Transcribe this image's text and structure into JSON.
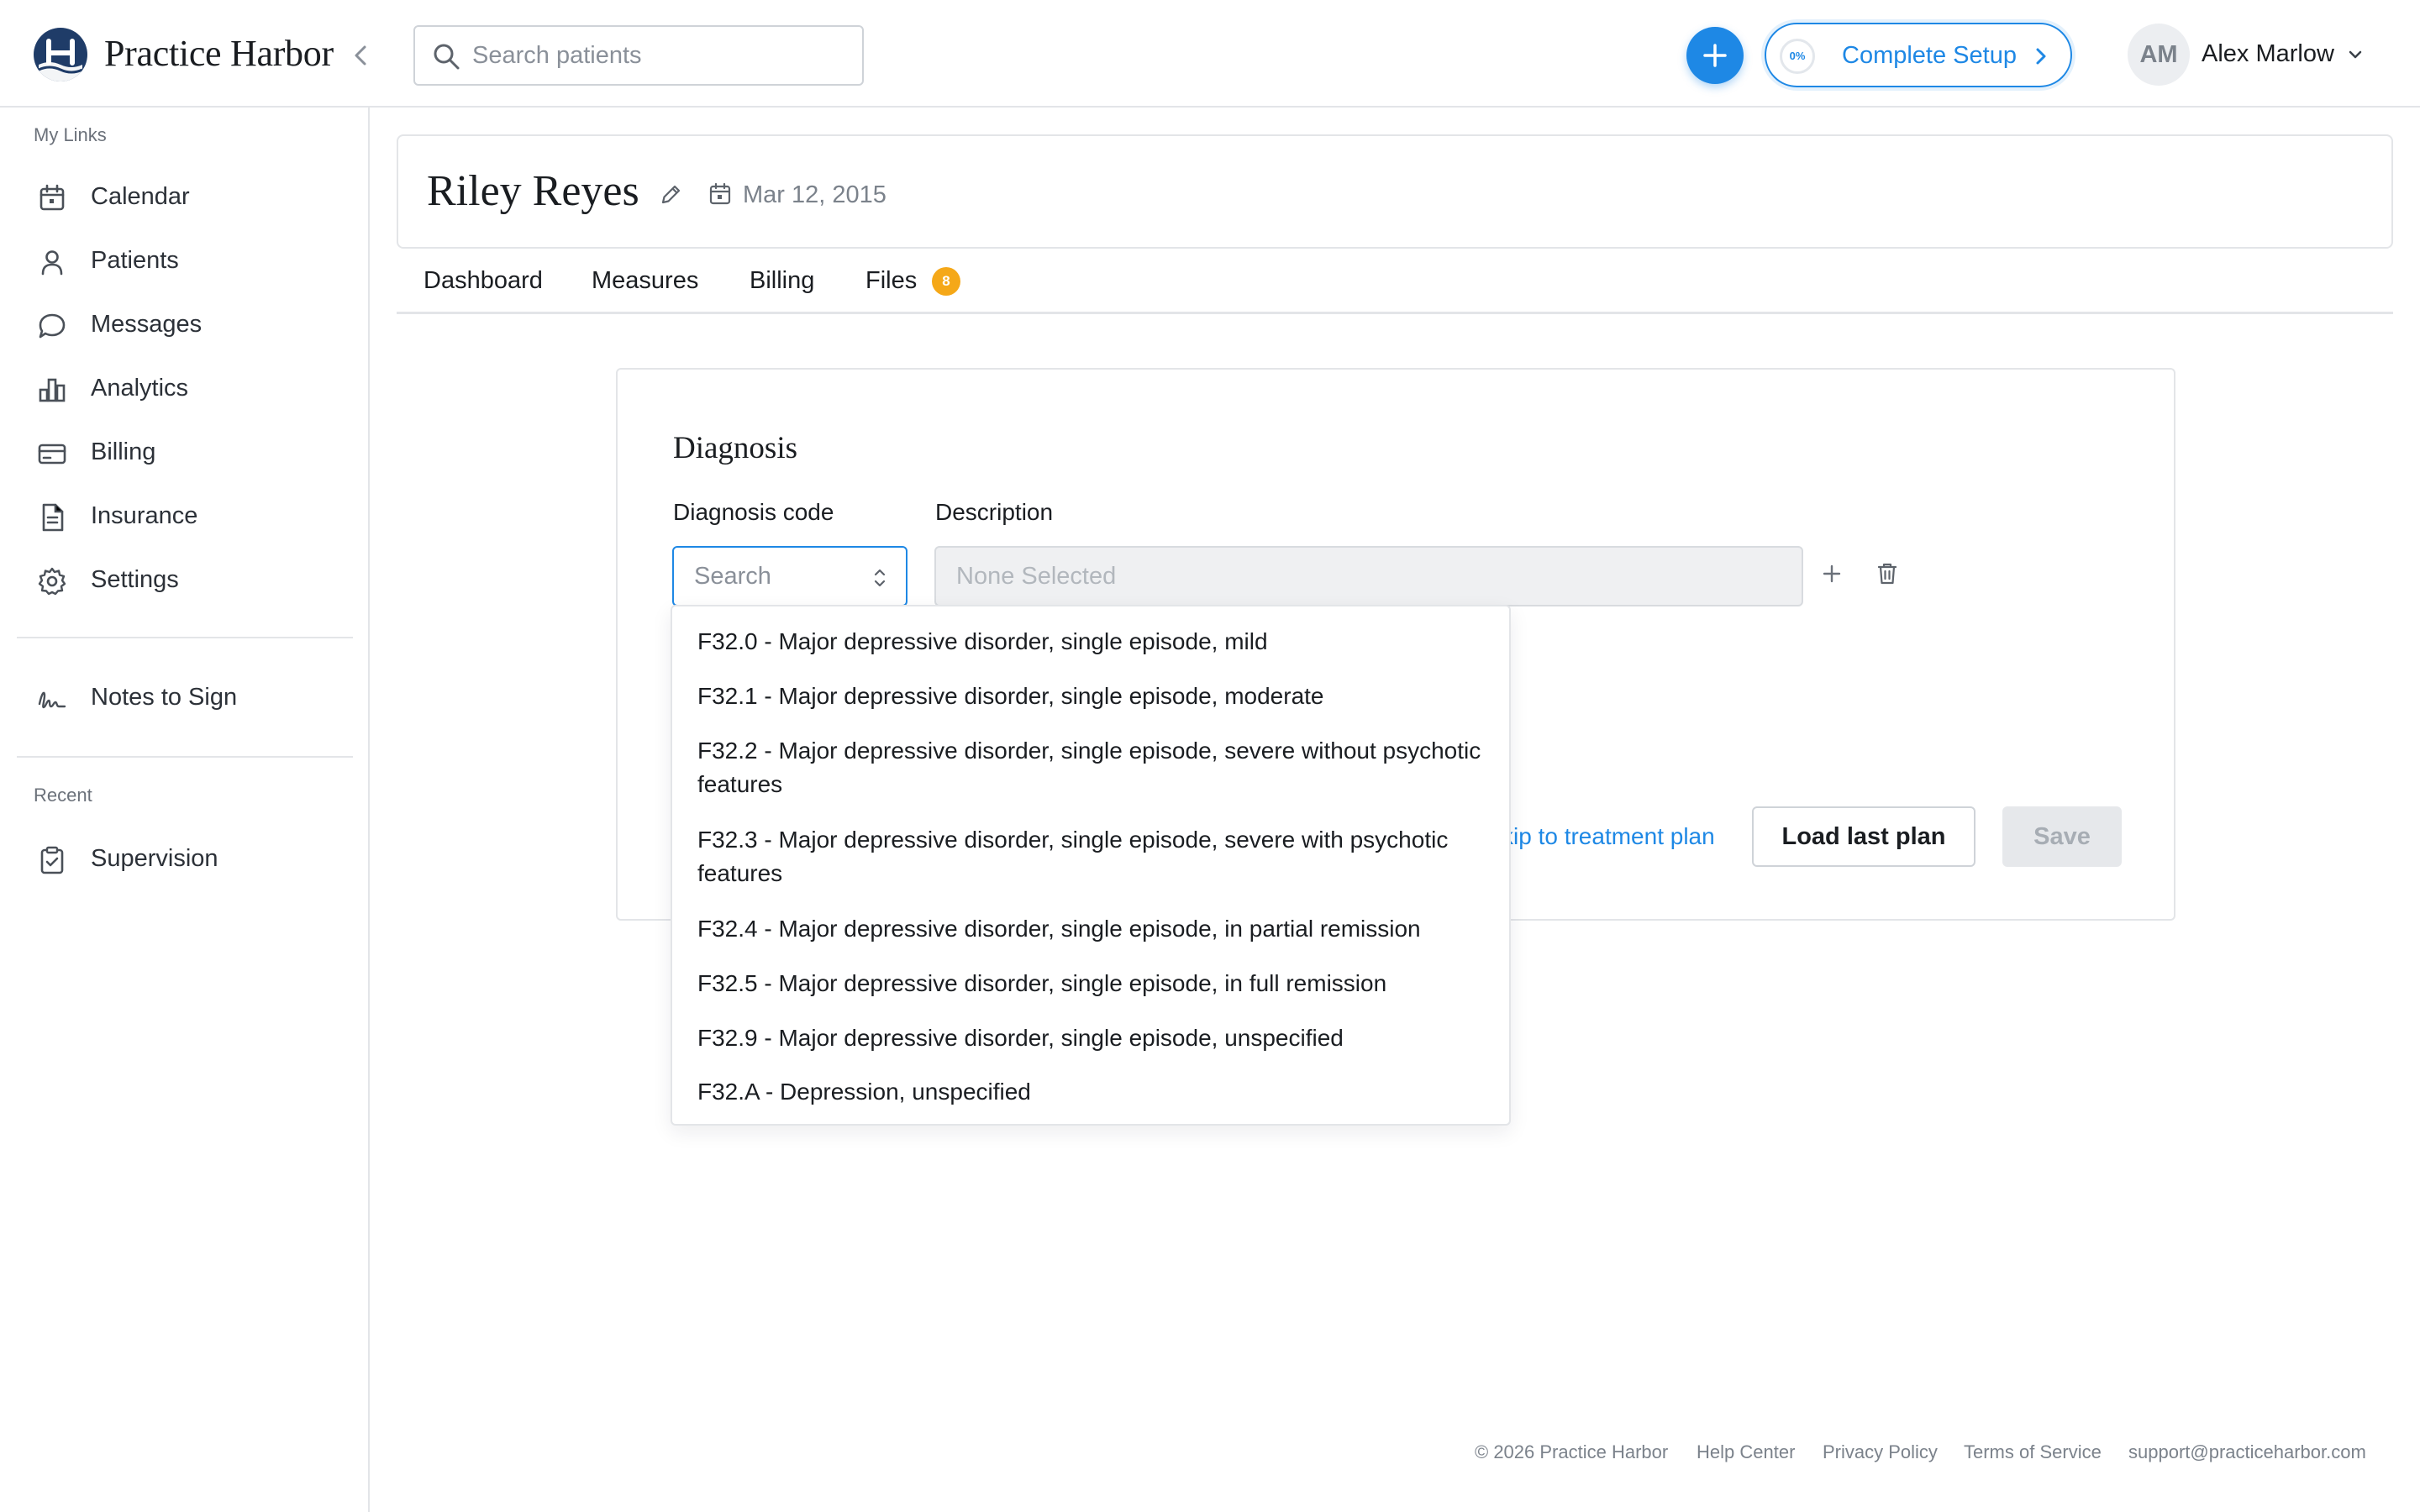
{
  "app": {
    "brand": "Practice Harbor",
    "collapse_icon": "chevron-left-icon"
  },
  "topbar": {
    "search_placeholder": "Search patients",
    "add_icon": "plus-icon",
    "setup": {
      "progress_label": "0%",
      "progress_value": 0,
      "label": "Complete Setup"
    },
    "user": {
      "initials": "AM",
      "name": "Alex Marlow"
    }
  },
  "sidebar": {
    "my_links_label": "My Links",
    "items": [
      {
        "label": "Calendar",
        "icon": "calendar-icon"
      },
      {
        "label": "Patients",
        "icon": "user-icon"
      },
      {
        "label": "Messages",
        "icon": "chat-bubble-icon"
      },
      {
        "label": "Analytics",
        "icon": "bar-chart-icon"
      },
      {
        "label": "Billing",
        "icon": "card-icon"
      },
      {
        "label": "Insurance",
        "icon": "document-icon"
      },
      {
        "label": "Settings",
        "icon": "gear-icon"
      }
    ],
    "notes_to_sign": "Notes to Sign",
    "recent_label": "Recent",
    "recent_items": [
      {
        "label": "Supervision",
        "icon": "clipboard-check-icon"
      }
    ]
  },
  "patient": {
    "name": "Riley Reyes",
    "dob": "Mar 12, 2015"
  },
  "tabs": [
    {
      "label": "Dashboard"
    },
    {
      "label": "Measures"
    },
    {
      "label": "Billing"
    },
    {
      "label": "Files",
      "badge": "8"
    }
  ],
  "diagnosis": {
    "title": "Diagnosis",
    "code_label": "Diagnosis code",
    "description_label": "Description",
    "code_placeholder": "Search",
    "description_placeholder": "None Selected",
    "options": [
      "F32.0 - Major depressive disorder, single episode, mild",
      "F32.1 - Major depressive disorder, single episode, moderate",
      "F32.2 - Major depressive disorder, single episode, severe without psychotic features",
      "F32.3 - Major depressive disorder, single episode, severe with psychotic features",
      "F32.4 - Major depressive disorder, single episode, in partial remission",
      "F32.5 - Major depressive disorder, single episode, in full remission",
      "F32.9 - Major depressive disorder, single episode, unspecified",
      "F32.A - Depression, unspecified"
    ],
    "skip_link": "kip to treatment plan",
    "load_button": "Load last plan",
    "save_button": "Save"
  },
  "footer": {
    "copyright": "© 2026 Practice Harbor",
    "help": "Help Center",
    "privacy": "Privacy Policy",
    "terms": "Terms of Service",
    "email": "support@practiceharbor.com"
  },
  "colors": {
    "accent": "#1e88e5",
    "badge": "#f5a818",
    "logo": "#1f3c68"
  }
}
